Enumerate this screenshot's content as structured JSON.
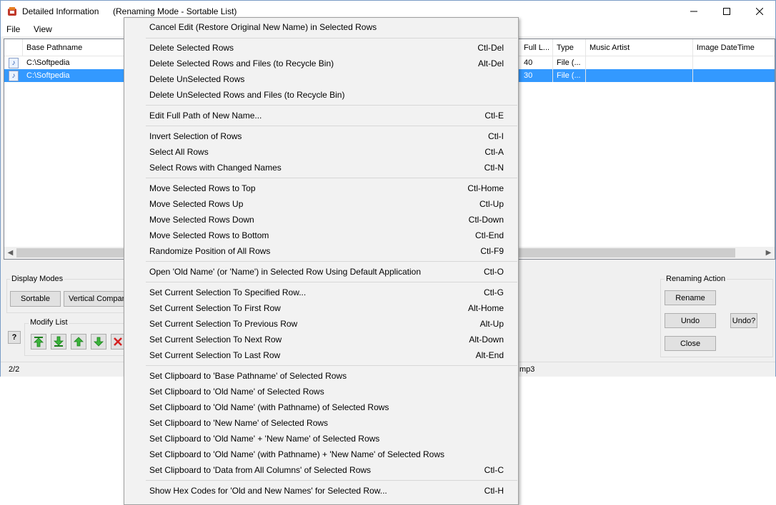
{
  "window": {
    "title": "Detailed Information",
    "mode": "(Renaming Mode - Sortable List)"
  },
  "menubar": {
    "file": "File",
    "view": "View"
  },
  "list": {
    "headers": [
      "Base Pathname",
      "Full L...",
      "Type",
      "Music Artist",
      "Image DateTime"
    ],
    "rows": [
      {
        "base": "C:\\Softpedia",
        "full": "40",
        "type": "File (..."
      },
      {
        "base": "C:\\Softpedia",
        "full": "30",
        "type": "File (..."
      }
    ]
  },
  "display_modes": {
    "label": "Display Modes",
    "sortable": "Sortable",
    "vertical": "Vertical Compare"
  },
  "modify_list": {
    "label": "Modify List",
    "help": "?"
  },
  "renaming_action": {
    "label": "Renaming Action",
    "rename": "Rename",
    "undo": "Undo",
    "undo_q": "Undo?",
    "close": "Close"
  },
  "status": {
    "count": "2/2",
    "ext": "mp3"
  },
  "context_menu": [
    {
      "label": "Cancel Edit (Restore Original New Name) in Selected Rows",
      "shortcut": ""
    },
    {
      "label": "Delete Selected Rows",
      "shortcut": "Ctl-Del"
    },
    {
      "label": "Delete Selected Rows and Files (to Recycle Bin)",
      "shortcut": "Alt-Del"
    },
    {
      "label": "Delete UnSelected Rows",
      "shortcut": ""
    },
    {
      "label": "Delete UnSelected Rows and Files (to Recycle Bin)",
      "shortcut": ""
    },
    {
      "label": "Edit Full Path of New Name...",
      "shortcut": "Ctl-E"
    },
    {
      "label": "Invert Selection of Rows",
      "shortcut": "Ctl-I"
    },
    {
      "label": "Select All Rows",
      "shortcut": "Ctl-A"
    },
    {
      "label": "Select Rows with Changed Names",
      "shortcut": "Ctl-N"
    },
    {
      "label": "Move Selected Rows to Top",
      "shortcut": "Ctl-Home"
    },
    {
      "label": "Move Selected Rows Up",
      "shortcut": "Ctl-Up"
    },
    {
      "label": "Move Selected Rows Down",
      "shortcut": "Ctl-Down"
    },
    {
      "label": "Move Selected Rows to Bottom",
      "shortcut": "Ctl-End"
    },
    {
      "label": "Randomize Position of All Rows",
      "shortcut": "Ctl-F9"
    },
    {
      "label": "Open 'Old Name' (or 'Name') in Selected Row Using Default Application",
      "shortcut": "Ctl-O"
    },
    {
      "label": "Set Current Selection To Specified Row...",
      "shortcut": "Ctl-G"
    },
    {
      "label": "Set Current Selection To First Row",
      "shortcut": "Alt-Home"
    },
    {
      "label": "Set Current Selection To Previous Row",
      "shortcut": "Alt-Up"
    },
    {
      "label": "Set Current Selection To Next Row",
      "shortcut": "Alt-Down"
    },
    {
      "label": "Set Current Selection To Last Row",
      "shortcut": "Alt-End"
    },
    {
      "label": "Set Clipboard to 'Base Pathname' of Selected Rows",
      "shortcut": ""
    },
    {
      "label": "Set Clipboard to 'Old Name' of Selected Rows",
      "shortcut": ""
    },
    {
      "label": "Set Clipboard to 'Old Name' (with Pathname) of Selected Rows",
      "shortcut": ""
    },
    {
      "label": "Set Clipboard to 'New Name' of Selected Rows",
      "shortcut": ""
    },
    {
      "label": "Set Clipboard to 'Old Name' + 'New Name' of Selected Rows",
      "shortcut": ""
    },
    {
      "label": "Set Clipboard to 'Old Name' (with Pathname) + 'New Name' of Selected Rows",
      "shortcut": ""
    },
    {
      "label": "Set Clipboard to 'Data from All Columns' of Selected Rows",
      "shortcut": "Ctl-C"
    },
    {
      "label": "Show Hex Codes for 'Old and New Names' for Selected Row...",
      "shortcut": "Ctl-H"
    }
  ]
}
